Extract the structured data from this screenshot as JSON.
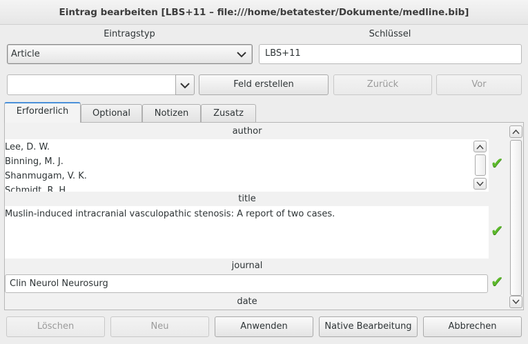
{
  "window": {
    "title": "Eintrag bearbeiten [LBS+11 – file:///home/betatester/Dokumente/medline.bib]"
  },
  "header": {
    "entry_type_label": "Eintragstyp",
    "entry_type_value": "Article",
    "key_label": "Schlüssel",
    "key_value": "LBS+11"
  },
  "field_bar": {
    "field_combo_value": "",
    "create_field_label": "Feld erstellen",
    "back_label": "Zurück",
    "forward_label": "Vor"
  },
  "tabs": [
    {
      "label": "Erforderlich"
    },
    {
      "label": "Optional"
    },
    {
      "label": "Notizen"
    },
    {
      "label": "Zusatz"
    }
  ],
  "fields": {
    "author": {
      "label": "author",
      "lines": [
        "Lee, D. W.",
        "Binning, M. J.",
        "Shanmugam, V. K.",
        "Schmidt, R. H."
      ]
    },
    "title": {
      "label": "title",
      "value": "Muslin-induced intracranial vasculopathic stenosis: A report of two cases."
    },
    "journal": {
      "label": "journal",
      "value": "Clin Neurol Neurosurg"
    },
    "date": {
      "label": "date"
    }
  },
  "buttons": {
    "delete_label": "Löschen",
    "new_label": "Neu",
    "apply_label": "Anwenden",
    "native_edit_label": "Native Bearbeitung",
    "cancel_label": "Abbrechen"
  },
  "icons": {
    "checkmark": "✔",
    "up_arrow": "⌃",
    "down_arrow": "⌄",
    "chevron": "⌄"
  },
  "colors": {
    "check_green": "#5cb82b",
    "tab_accent": "#4a90d9"
  }
}
